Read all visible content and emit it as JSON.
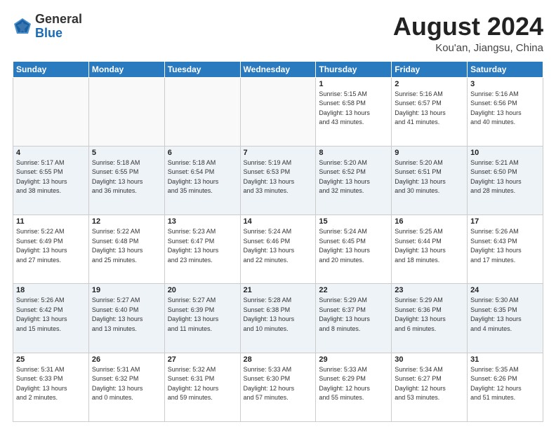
{
  "header": {
    "logo_general": "General",
    "logo_blue": "Blue",
    "month_year": "August 2024",
    "location": "Kou'an, Jiangsu, China"
  },
  "days_of_week": [
    "Sunday",
    "Monday",
    "Tuesday",
    "Wednesday",
    "Thursday",
    "Friday",
    "Saturday"
  ],
  "weeks": [
    [
      {
        "day": "",
        "info": ""
      },
      {
        "day": "",
        "info": ""
      },
      {
        "day": "",
        "info": ""
      },
      {
        "day": "",
        "info": ""
      },
      {
        "day": "1",
        "info": "Sunrise: 5:15 AM\nSunset: 6:58 PM\nDaylight: 13 hours\nand 43 minutes."
      },
      {
        "day": "2",
        "info": "Sunrise: 5:16 AM\nSunset: 6:57 PM\nDaylight: 13 hours\nand 41 minutes."
      },
      {
        "day": "3",
        "info": "Sunrise: 5:16 AM\nSunset: 6:56 PM\nDaylight: 13 hours\nand 40 minutes."
      }
    ],
    [
      {
        "day": "4",
        "info": "Sunrise: 5:17 AM\nSunset: 6:55 PM\nDaylight: 13 hours\nand 38 minutes."
      },
      {
        "day": "5",
        "info": "Sunrise: 5:18 AM\nSunset: 6:55 PM\nDaylight: 13 hours\nand 36 minutes."
      },
      {
        "day": "6",
        "info": "Sunrise: 5:18 AM\nSunset: 6:54 PM\nDaylight: 13 hours\nand 35 minutes."
      },
      {
        "day": "7",
        "info": "Sunrise: 5:19 AM\nSunset: 6:53 PM\nDaylight: 13 hours\nand 33 minutes."
      },
      {
        "day": "8",
        "info": "Sunrise: 5:20 AM\nSunset: 6:52 PM\nDaylight: 13 hours\nand 32 minutes."
      },
      {
        "day": "9",
        "info": "Sunrise: 5:20 AM\nSunset: 6:51 PM\nDaylight: 13 hours\nand 30 minutes."
      },
      {
        "day": "10",
        "info": "Sunrise: 5:21 AM\nSunset: 6:50 PM\nDaylight: 13 hours\nand 28 minutes."
      }
    ],
    [
      {
        "day": "11",
        "info": "Sunrise: 5:22 AM\nSunset: 6:49 PM\nDaylight: 13 hours\nand 27 minutes."
      },
      {
        "day": "12",
        "info": "Sunrise: 5:22 AM\nSunset: 6:48 PM\nDaylight: 13 hours\nand 25 minutes."
      },
      {
        "day": "13",
        "info": "Sunrise: 5:23 AM\nSunset: 6:47 PM\nDaylight: 13 hours\nand 23 minutes."
      },
      {
        "day": "14",
        "info": "Sunrise: 5:24 AM\nSunset: 6:46 PM\nDaylight: 13 hours\nand 22 minutes."
      },
      {
        "day": "15",
        "info": "Sunrise: 5:24 AM\nSunset: 6:45 PM\nDaylight: 13 hours\nand 20 minutes."
      },
      {
        "day": "16",
        "info": "Sunrise: 5:25 AM\nSunset: 6:44 PM\nDaylight: 13 hours\nand 18 minutes."
      },
      {
        "day": "17",
        "info": "Sunrise: 5:26 AM\nSunset: 6:43 PM\nDaylight: 13 hours\nand 17 minutes."
      }
    ],
    [
      {
        "day": "18",
        "info": "Sunrise: 5:26 AM\nSunset: 6:42 PM\nDaylight: 13 hours\nand 15 minutes."
      },
      {
        "day": "19",
        "info": "Sunrise: 5:27 AM\nSunset: 6:40 PM\nDaylight: 13 hours\nand 13 minutes."
      },
      {
        "day": "20",
        "info": "Sunrise: 5:27 AM\nSunset: 6:39 PM\nDaylight: 13 hours\nand 11 minutes."
      },
      {
        "day": "21",
        "info": "Sunrise: 5:28 AM\nSunset: 6:38 PM\nDaylight: 13 hours\nand 10 minutes."
      },
      {
        "day": "22",
        "info": "Sunrise: 5:29 AM\nSunset: 6:37 PM\nDaylight: 13 hours\nand 8 minutes."
      },
      {
        "day": "23",
        "info": "Sunrise: 5:29 AM\nSunset: 6:36 PM\nDaylight: 13 hours\nand 6 minutes."
      },
      {
        "day": "24",
        "info": "Sunrise: 5:30 AM\nSunset: 6:35 PM\nDaylight: 13 hours\nand 4 minutes."
      }
    ],
    [
      {
        "day": "25",
        "info": "Sunrise: 5:31 AM\nSunset: 6:33 PM\nDaylight: 13 hours\nand 2 minutes."
      },
      {
        "day": "26",
        "info": "Sunrise: 5:31 AM\nSunset: 6:32 PM\nDaylight: 13 hours\nand 0 minutes."
      },
      {
        "day": "27",
        "info": "Sunrise: 5:32 AM\nSunset: 6:31 PM\nDaylight: 12 hours\nand 59 minutes."
      },
      {
        "day": "28",
        "info": "Sunrise: 5:33 AM\nSunset: 6:30 PM\nDaylight: 12 hours\nand 57 minutes."
      },
      {
        "day": "29",
        "info": "Sunrise: 5:33 AM\nSunset: 6:29 PM\nDaylight: 12 hours\nand 55 minutes."
      },
      {
        "day": "30",
        "info": "Sunrise: 5:34 AM\nSunset: 6:27 PM\nDaylight: 12 hours\nand 53 minutes."
      },
      {
        "day": "31",
        "info": "Sunrise: 5:35 AM\nSunset: 6:26 PM\nDaylight: 12 hours\nand 51 minutes."
      }
    ]
  ]
}
